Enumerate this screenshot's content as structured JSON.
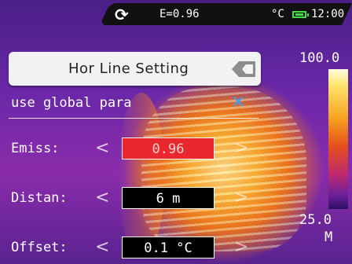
{
  "status_bar": {
    "refresh_icon": "refresh-icon",
    "emissivity": "E=0.96",
    "temp_unit": "°C",
    "battery_icon": "battery-icon",
    "battery_color": "#3fe03f",
    "time": "12:00"
  },
  "scale": {
    "max": "100.0",
    "min": "25.0",
    "mode": "M"
  },
  "panel": {
    "title": "Hor Line Setting",
    "back_icon": "back-arrow-icon",
    "global_label": "use global para",
    "global_icon": "close-icon",
    "global_icon_color": "#3aa0ff",
    "rows": [
      {
        "label": "Emiss:",
        "value": "0.96",
        "selected": true,
        "selected_color": "#e8282d"
      },
      {
        "label": "Distan:",
        "value": "6 m"
      },
      {
        "label": "Offset:",
        "value": "0.1 °C"
      }
    ],
    "left_arrow": "<",
    "right_arrow": ">"
  }
}
